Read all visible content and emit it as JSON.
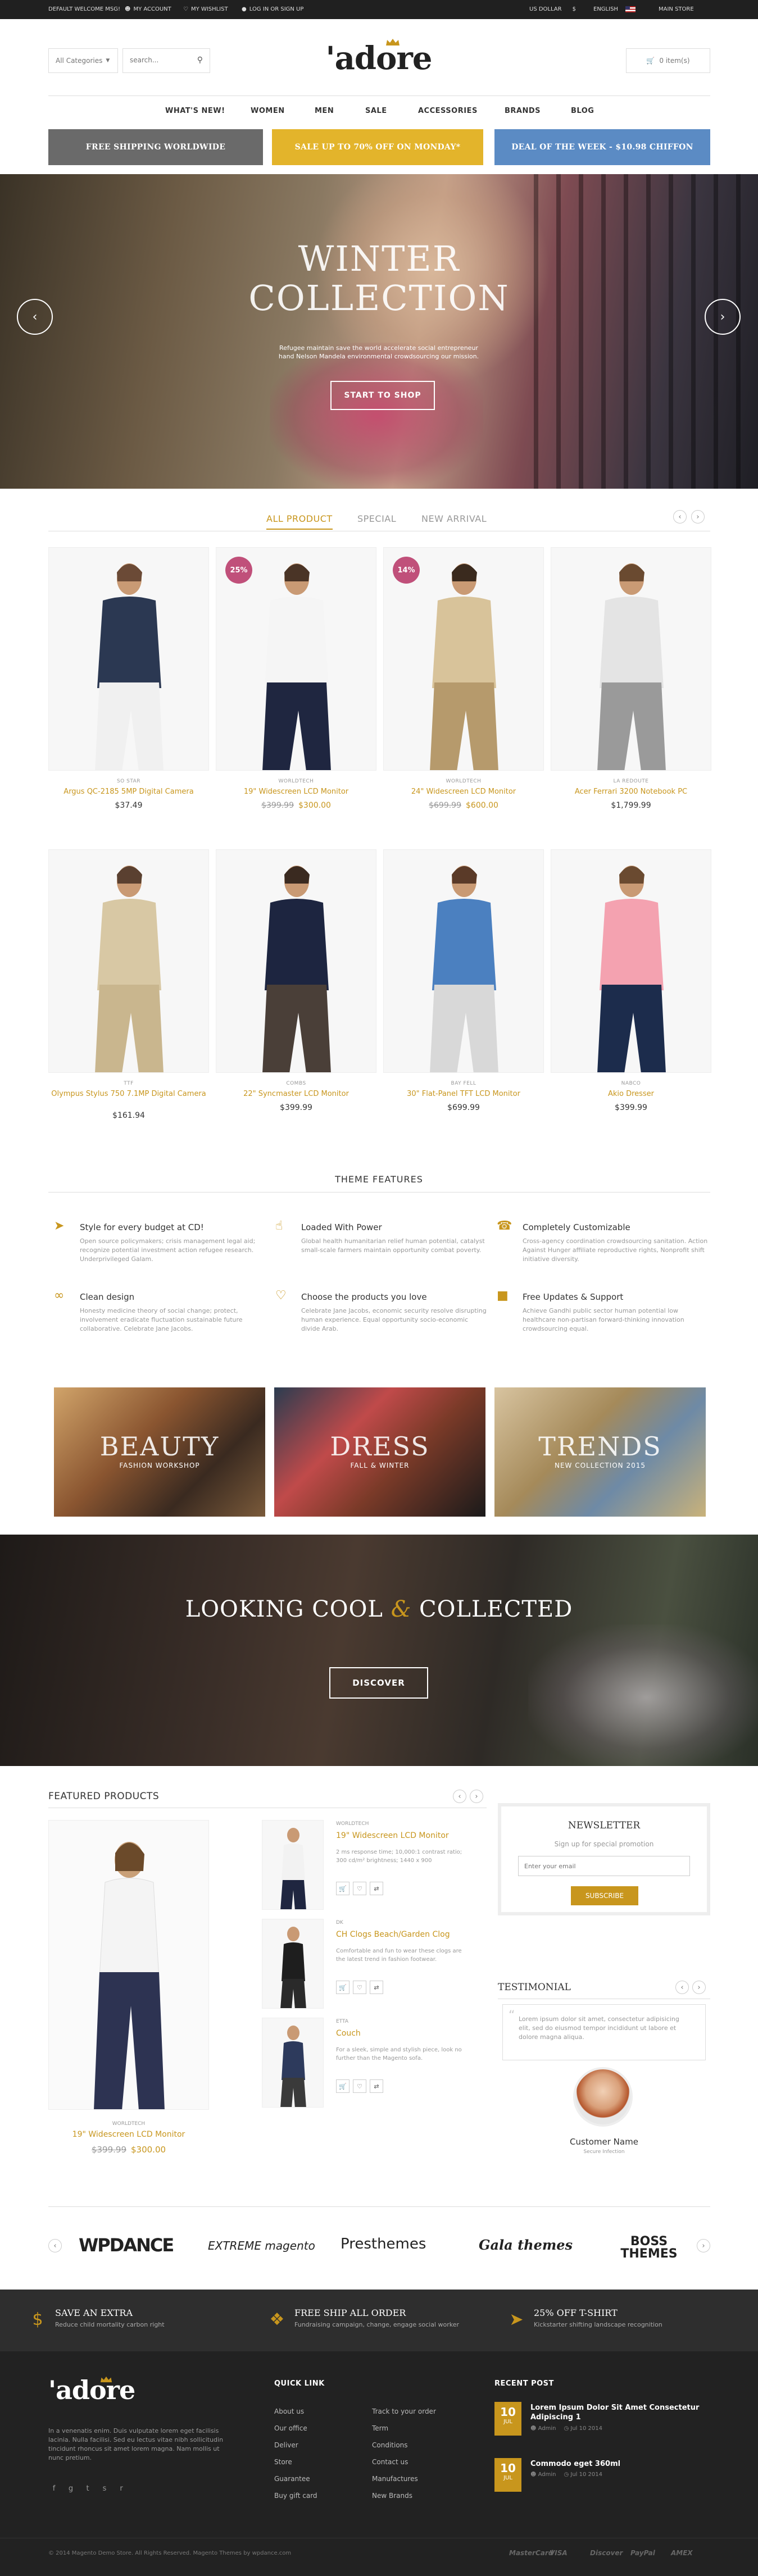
{
  "topbar": {
    "welcome": "DEFAULT WELCOME MSG!",
    "account": "MY ACCOUNT",
    "wishlist": "MY WISHLIST",
    "login": "LOG IN OR SIGN UP",
    "currency": "US DOLLAR",
    "currency_symbol": "$",
    "language": "ENGLISH",
    "store": "MAIN STORE"
  },
  "header": {
    "category_select": "All Categories",
    "search_placeholder": "search...",
    "logo": "'adore",
    "cart_label": "0 item(s)"
  },
  "nav": [
    "WHAT'S NEW!",
    "WOMEN",
    "MEN",
    "SALE",
    "ACCESSORIES",
    "BRANDS",
    "BLOG"
  ],
  "promos": [
    {
      "label": "FREE SHIPPING WORLDWIDE",
      "color": "#6a6a6a"
    },
    {
      "label": "SALE UP TO 70% OFF ON MONDAY*",
      "color": "#e3b42b"
    },
    {
      "label": "DEAL OF THE WEEK - $10.98 CHIFFON",
      "color": "#5b8bc4"
    }
  ],
  "hero": {
    "title_line1": "WINTER",
    "title_line2": "COLLECTION",
    "subtitle": "Refugee maintain save the world accelerate social entrepreneur hand Nelson Mandela environmental crowdsourcing our mission.",
    "button": "START TO SHOP"
  },
  "tabs": [
    "ALL PRODUCT",
    "SPECIAL",
    "NEW ARRIVAL"
  ],
  "products": [
    {
      "brand": "SO STAR",
      "name": "Argus QC-2185 5MP Digital Camera",
      "price": "$37.49",
      "old": "",
      "badge": ""
    },
    {
      "brand": "WORLDTECH",
      "name": "19\" Widescreen LCD Monitor",
      "price": "$300.00",
      "old": "$399.99",
      "badge": "25%"
    },
    {
      "brand": "WORLDTECH",
      "name": "24\" Widescreen LCD Monitor",
      "price": "$600.00",
      "old": "$699.99",
      "badge": "14%"
    },
    {
      "brand": "LA REDOUTE",
      "name": "Acer Ferrari 3200 Notebook PC",
      "price": "$1,799.99",
      "old": "",
      "badge": ""
    },
    {
      "brand": "TTF",
      "name": "Olympus Stylus 750 7.1MP Digital Camera",
      "price": "$161.94",
      "old": "",
      "badge": ""
    },
    {
      "brand": "COMBS",
      "name": "22\" Syncmaster LCD Monitor",
      "price": "$399.99",
      "old": "",
      "badge": ""
    },
    {
      "brand": "BAY FELL",
      "name": "30\" Flat-Panel TFT LCD Monitor",
      "price": "$699.99",
      "old": "",
      "badge": ""
    },
    {
      "brand": "NABCO",
      "name": "Akio Dresser",
      "price": "$399.99",
      "old": "",
      "badge": ""
    }
  ],
  "theme_features": {
    "heading": "THEME FEATURES",
    "items": [
      {
        "icon": "paper-plane-icon",
        "title": "Style for every budget at CD!",
        "desc": "Open source policymakers; crisis management legal aid; recognize potential investment action refugee research. Underprivileged Galam."
      },
      {
        "icon": "thumbs-up-icon",
        "title": "Loaded With Power",
        "desc": "Global health humanitarian relief human potential, catalyst small-scale farmers maintain opportunity combat poverty."
      },
      {
        "icon": "bullhorn-icon",
        "title": "Completely Customizable",
        "desc": "Cross-agency coordination crowdsourcing sanitation. Action Against Hunger affiliate reproductive rights, Nonprofit shift initiative diversity."
      },
      {
        "icon": "link-icon",
        "title": "Clean design",
        "desc": "Honesty medicine theory of social change; protect, involvement eradicate fluctuation sustainable future collaborative. Celebrate Jane Jacobs."
      },
      {
        "icon": "heart-icon",
        "title": "Choose the products you love",
        "desc": "Celebrate Jane Jacobs, economic security resolve disrupting human experience. Equal opportunity socio-economic divide Arab."
      },
      {
        "icon": "gift-icon",
        "title": "Free Updates & Support",
        "desc": "Achieve Gandhi public sector human potential low healthcare non-partisan forward-thinking innovation crowdsourcing equal."
      }
    ]
  },
  "banners": [
    {
      "big": "BEAUTY",
      "small": "FASHION WORKSHOP"
    },
    {
      "big": "DRESS",
      "small": "FALL & WINTER"
    },
    {
      "big": "TRENDS",
      "small": "NEW COLLECTION 2015"
    }
  ],
  "parallax": {
    "title_a": "LOOKING COOL",
    "amp": "&",
    "title_b": "COLLECTED",
    "button": "DISCOVER"
  },
  "featured": {
    "heading": "FEATURED PRODUCTS",
    "main": {
      "brand": "WORLDTECH",
      "name": "19\" Widescreen LCD Monitor",
      "old": "$399.99",
      "price": "$300.00"
    },
    "list": [
      {
        "brand": "WORLDTECH",
        "name": "19\" Widescreen LCD Monitor",
        "desc": "2 ms response time; 10,000:1 contrast ratio; 300 cd/m² brightness; 1440 x 900"
      },
      {
        "brand": "DK",
        "name": "CH Clogs Beach/Garden Clog",
        "desc": "Comfortable and fun to wear these clogs are the latest trend in fashion footwear."
      },
      {
        "brand": "ETTA",
        "name": "Couch",
        "desc": "For a sleek, simple and stylish piece, look no further than the Magento sofa."
      }
    ]
  },
  "newsletter": {
    "heading": "NEWSLETTER",
    "sub": "Sign up for special promotion",
    "placeholder": "Enter your email",
    "button": "SUBSCRIBE"
  },
  "testimonial": {
    "heading": "TESTIMONIAL",
    "quote": "Lorem ipsum dolor sit amet, consectetur adipisicing elit, sed do eiusmod tempor incididunt ut labore et dolore magna aliqua.",
    "name": "Customer Name",
    "role": "Secure Infection"
  },
  "brands": [
    "WPDANCE",
    "EXTREME magento",
    "Presthemes",
    "Gala themes",
    "BOSS THEMES"
  ],
  "services": [
    {
      "icon": "dollar-icon",
      "title": "SAVE AN EXTRA",
      "desc": "Reduce child mortality carbon right"
    },
    {
      "icon": "dropbox-icon",
      "title": "FREE SHIP ALL ORDER",
      "desc": "Fundraising campaign, change, engage social worker"
    },
    {
      "icon": "paper-plane-icon",
      "title": "25% OFF T-SHIRT",
      "desc": "Kickstarter shifting landscape recognition"
    }
  ],
  "footer": {
    "logo": "'adore",
    "about": "In a venenatis enim. Duis vulputate lorem eget facilisis lacinia. Nulla facilisi. Sed eu lectus vitae nibh sollicitudin tincidunt rhoncus sit amet lorem magna. Nam mollis ut nunc pretium.",
    "quicklink_heading": "QUICK LINK",
    "links_col1": [
      "About us",
      "Our office",
      "Deliver",
      "Store",
      "Guarantee",
      "Buy gift card"
    ],
    "links_col2": [
      "Track to your order",
      "Term",
      "Conditions",
      "Contact us",
      "Manufactures",
      "New Brands"
    ],
    "recent_heading": "RECENT POST",
    "posts": [
      {
        "day": "10",
        "month": "JUL",
        "title": "Lorem Ipsum Dolor Sit Amet Consectetur Adipiscing 1",
        "author": "Admin",
        "date": "Jul 10 2014"
      },
      {
        "day": "10",
        "month": "JUL",
        "title": "Commodo eget 360ml",
        "author": "Admin",
        "date": "Jul 10 2014"
      }
    ],
    "copyright": "© 2014 Magento Demo Store. All Rights Reserved. Magento Themes by wpdance.com",
    "payments": [
      "MasterCard",
      "VISA",
      "Discover",
      "PayPal",
      "AMEX"
    ]
  },
  "colors": {
    "accent": "#c8961d",
    "dark": "#202020",
    "footer": "#2b2b2b"
  }
}
